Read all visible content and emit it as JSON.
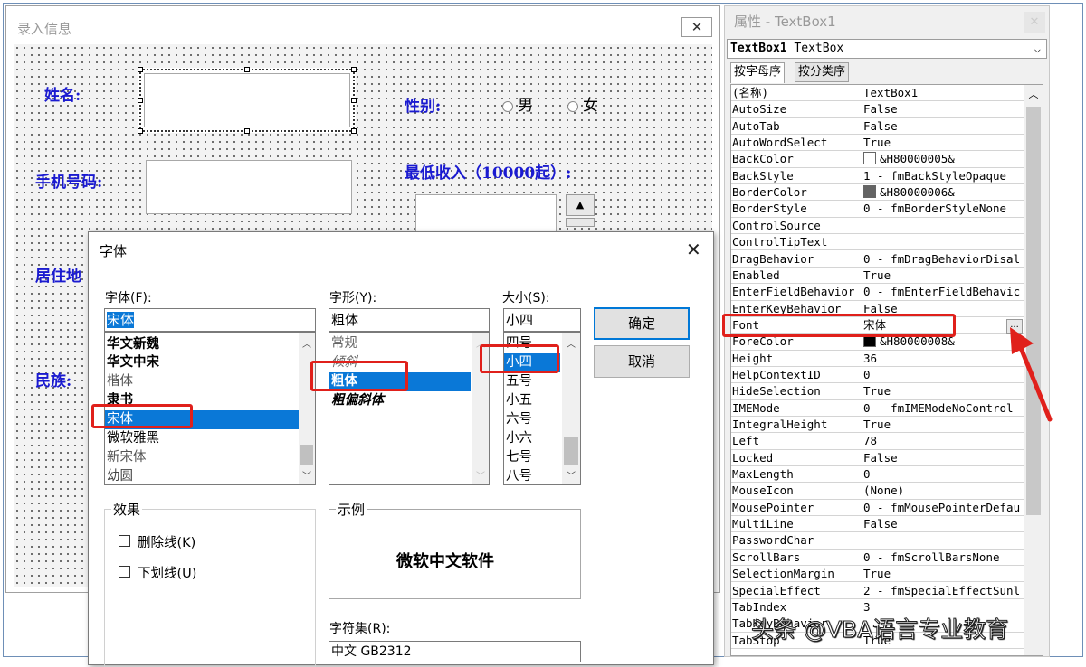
{
  "form": {
    "title": "录入信息",
    "close_icon": "✕",
    "labels": {
      "name": "姓名:",
      "phone": "手机号码:",
      "gender": "性别:",
      "min_income": "最低收入（10000起）:",
      "residence": "居住地",
      "ethnicity": "民族:"
    },
    "gender_options": [
      "男",
      "女"
    ]
  },
  "properties": {
    "title": "属性 - TextBox1",
    "close_icon": "✕",
    "object_name": "TextBox1",
    "object_type": "TextBox",
    "tabs": [
      "按字母序",
      "按分类序"
    ],
    "rows": [
      {
        "name": "(名称)",
        "value": "TextBox1"
      },
      {
        "name": "AutoSize",
        "value": "False"
      },
      {
        "name": "AutoTab",
        "value": "False"
      },
      {
        "name": "AutoWordSelect",
        "value": "True"
      },
      {
        "name": "BackColor",
        "value": "&H80000005&",
        "swatch": "#ffffff"
      },
      {
        "name": "BackStyle",
        "value": "1 - fmBackStyleOpaque"
      },
      {
        "name": "BorderColor",
        "value": "&H80000006&",
        "swatch": "#646464"
      },
      {
        "name": "BorderStyle",
        "value": "0 - fmBorderStyleNone"
      },
      {
        "name": "ControlSource",
        "value": ""
      },
      {
        "name": "ControlTipText",
        "value": ""
      },
      {
        "name": "DragBehavior",
        "value": "0 - fmDragBehaviorDisal"
      },
      {
        "name": "Enabled",
        "value": "True"
      },
      {
        "name": "EnterFieldBehavior",
        "value": "0 - fmEnterFieldBehavic"
      },
      {
        "name": "EnterKeyBehavior",
        "value": "False"
      },
      {
        "name": "Font",
        "value": "宋体"
      },
      {
        "name": "ForeColor",
        "value": "&H80000008&",
        "swatch": "#000000"
      },
      {
        "name": "Height",
        "value": "36"
      },
      {
        "name": "HelpContextID",
        "value": "0"
      },
      {
        "name": "HideSelection",
        "value": "True"
      },
      {
        "name": "IMEMode",
        "value": "0 - fmIMEModeNoControl"
      },
      {
        "name": "IntegralHeight",
        "value": "True"
      },
      {
        "name": "Left",
        "value": "78"
      },
      {
        "name": "Locked",
        "value": "False"
      },
      {
        "name": "MaxLength",
        "value": "0"
      },
      {
        "name": "MouseIcon",
        "value": "(None)"
      },
      {
        "name": "MousePointer",
        "value": "0 - fmMousePointerDefau"
      },
      {
        "name": "MultiLine",
        "value": "False"
      },
      {
        "name": "PasswordChar",
        "value": ""
      },
      {
        "name": "ScrollBars",
        "value": "0 - fmScrollBarsNone"
      },
      {
        "name": "SelectionMargin",
        "value": "True"
      },
      {
        "name": "SpecialEffect",
        "value": "2 - fmSpecialEffectSunl"
      },
      {
        "name": "TabIndex",
        "value": "3"
      },
      {
        "name": "TabKeyBehavior",
        "value": ""
      },
      {
        "name": "TabStop",
        "value": "True"
      }
    ],
    "font_ellipsis": "..."
  },
  "font_dialog": {
    "title": "字体",
    "close_icon": "✕",
    "font_label": "字体(F):",
    "font_value": "宋体",
    "font_list": [
      "华文新魏",
      "华文中宋",
      "楷体",
      "隶书",
      "宋体",
      "微软雅黑",
      "新宋体",
      "幼圆"
    ],
    "style_label": "字形(Y):",
    "style_value": "粗体",
    "style_list": [
      "常规",
      "倾斜",
      "粗体",
      "粗偏斜体"
    ],
    "size_label": "大小(S):",
    "size_value": "小四",
    "size_list": [
      "四号",
      "小四",
      "五号",
      "小五",
      "六号",
      "小六",
      "七号",
      "八号"
    ],
    "ok_label": "确定",
    "cancel_label": "取消",
    "effects_label": "效果",
    "strikeout_label": "删除线(K)",
    "underline_label": "下划线(U)",
    "sample_label": "示例",
    "sample_text": "微软中文软件",
    "charset_label": "字符集(R):",
    "charset_value": "中文 GB2312"
  },
  "colors": {
    "highlight_red": "#e0201b",
    "selection_blue": "#0a78d7",
    "form_label_blue": "#1a1ad0"
  },
  "watermark": "头条 @VBA语言专业教育"
}
